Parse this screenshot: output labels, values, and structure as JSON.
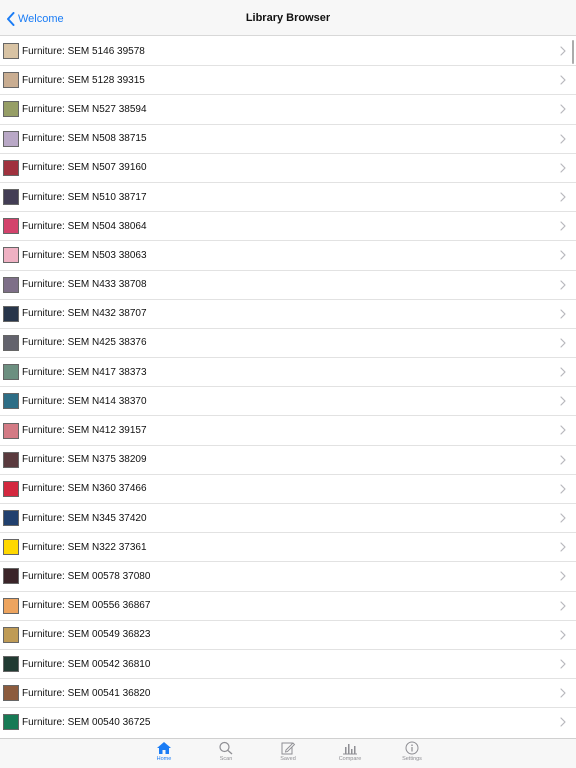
{
  "navbar": {
    "back_label": "Welcome",
    "title": "Library Browser"
  },
  "list": [
    {
      "label": "Furniture: SEM 5146 39578",
      "color": "#d8c3a4"
    },
    {
      "label": "Furniture: SEM 5128 39315",
      "color": "#c9ad91"
    },
    {
      "label": "Furniture: SEM N527 38594",
      "color": "#969e66"
    },
    {
      "label": "Furniture: SEM N508 38715",
      "color": "#b9a8c6"
    },
    {
      "label": "Furniture: SEM N507 39160",
      "color": "#a0323e"
    },
    {
      "label": "Furniture: SEM N510 38717",
      "color": "#433d55"
    },
    {
      "label": "Furniture: SEM N504 38064",
      "color": "#d3436c"
    },
    {
      "label": "Furniture: SEM N503 38063",
      "color": "#efb1c3"
    },
    {
      "label": "Furniture: SEM N433 38708",
      "color": "#7e6f88"
    },
    {
      "label": "Furniture: SEM N432 38707",
      "color": "#27354a"
    },
    {
      "label": "Furniture: SEM N425 38376",
      "color": "#63636d"
    },
    {
      "label": "Furniture: SEM N417 38373",
      "color": "#6c8f80"
    },
    {
      "label": "Furniture: SEM N414 38370",
      "color": "#2e6e86"
    },
    {
      "label": "Furniture: SEM N412 39157",
      "color": "#d37b85"
    },
    {
      "label": "Furniture: SEM N375 38209",
      "color": "#5a3a3e"
    },
    {
      "label": "Furniture: SEM N360 37466",
      "color": "#d3283f"
    },
    {
      "label": "Furniture: SEM N345 37420",
      "color": "#21406e"
    },
    {
      "label": "Furniture: SEM N322 37361",
      "color": "#ffd800"
    },
    {
      "label": "Furniture: SEM 00578 37080",
      "color": "#3a2428"
    },
    {
      "label": "Furniture: SEM 00556 36867",
      "color": "#eda45f"
    },
    {
      "label": "Furniture: SEM 00549 36823",
      "color": "#bf9b56"
    },
    {
      "label": "Furniture: SEM 00542 36810",
      "color": "#213a32"
    },
    {
      "label": "Furniture: SEM 00541 36820",
      "color": "#8c5b3d"
    },
    {
      "label": "Furniture: SEM 00540 36725",
      "color": "#177a55"
    }
  ],
  "tabs": [
    {
      "label": "Home",
      "icon": "home-icon",
      "active": true
    },
    {
      "label": "Scan",
      "icon": "search-icon",
      "active": false
    },
    {
      "label": "Saved",
      "icon": "edit-icon",
      "active": false
    },
    {
      "label": "Compare",
      "icon": "bar-chart-icon",
      "active": false
    },
    {
      "label": "Settings",
      "icon": "info-icon",
      "active": false
    }
  ],
  "colors": {
    "accent": "#1a7cf5",
    "inactive": "#8e8e93"
  }
}
